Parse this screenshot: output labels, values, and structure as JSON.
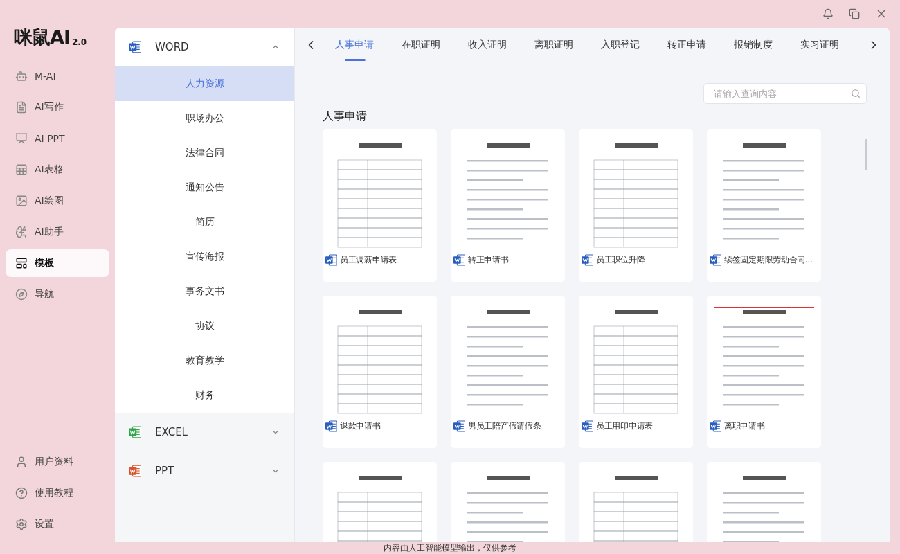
{
  "app": {
    "logo": "咪鼠AI",
    "version": "2.0"
  },
  "nav": [
    {
      "label": "M-AI",
      "selected": false
    },
    {
      "label": "AI写作",
      "selected": false
    },
    {
      "label": "AI PPT",
      "selected": false
    },
    {
      "label": "AI表格",
      "selected": false
    },
    {
      "label": "AI绘图",
      "selected": false
    },
    {
      "label": "AI助手",
      "selected": false
    },
    {
      "label": "模板",
      "selected": true
    },
    {
      "label": "导航",
      "selected": false
    }
  ],
  "nav_footer": [
    {
      "label": "用户资料"
    },
    {
      "label": "使用教程"
    },
    {
      "label": "设置"
    }
  ],
  "categories": [
    {
      "kind": "word",
      "label": "WORD",
      "expanded": true,
      "children": [
        {
          "label": "人力资源",
          "selected": true
        },
        {
          "label": "职场办公",
          "selected": false
        },
        {
          "label": "法律合同",
          "selected": false
        },
        {
          "label": "通知公告",
          "selected": false
        },
        {
          "label": "简历",
          "selected": false
        },
        {
          "label": "宣传海报",
          "selected": false
        },
        {
          "label": "事务文书",
          "selected": false
        },
        {
          "label": "协议",
          "selected": false
        },
        {
          "label": "教育教学",
          "selected": false
        },
        {
          "label": "财务",
          "selected": false
        }
      ]
    },
    {
      "kind": "excel",
      "label": "EXCEL",
      "expanded": false
    },
    {
      "kind": "ppt",
      "label": "PPT",
      "expanded": false
    }
  ],
  "tabs": [
    {
      "label": "人事申请",
      "selected": true
    },
    {
      "label": "在职证明",
      "selected": false
    },
    {
      "label": "收入证明",
      "selected": false
    },
    {
      "label": "离职证明",
      "selected": false
    },
    {
      "label": "入职登记",
      "selected": false
    },
    {
      "label": "转正申请",
      "selected": false
    },
    {
      "label": "报销制度",
      "selected": false
    },
    {
      "label": "实习证明",
      "selected": false
    }
  ],
  "search": {
    "placeholder": "请输入查询内容"
  },
  "section_title": "人事申请",
  "templates": [
    {
      "kind": "preview",
      "title": "员工调薪申请表"
    },
    {
      "kind": "preview",
      "title": "转正申请书"
    },
    {
      "kind": "preview",
      "title": "员工职位升降"
    },
    {
      "kind": "preview",
      "title": "续签固定期限劳动合同..."
    },
    {
      "kind": "preview",
      "title": "退款申请书"
    },
    {
      "kind": "preview",
      "title": "男员工陪产假请假条"
    },
    {
      "kind": "preview",
      "title": "员工用印申请表"
    },
    {
      "kind": "preview",
      "title": "离职申请书"
    },
    {
      "kind": "preview"
    },
    {
      "kind": "preview"
    },
    {
      "kind": "preview"
    },
    {
      "kind": "preview"
    }
  ],
  "disclaimer": "内容由人工智能模型输出，仅供参考"
}
